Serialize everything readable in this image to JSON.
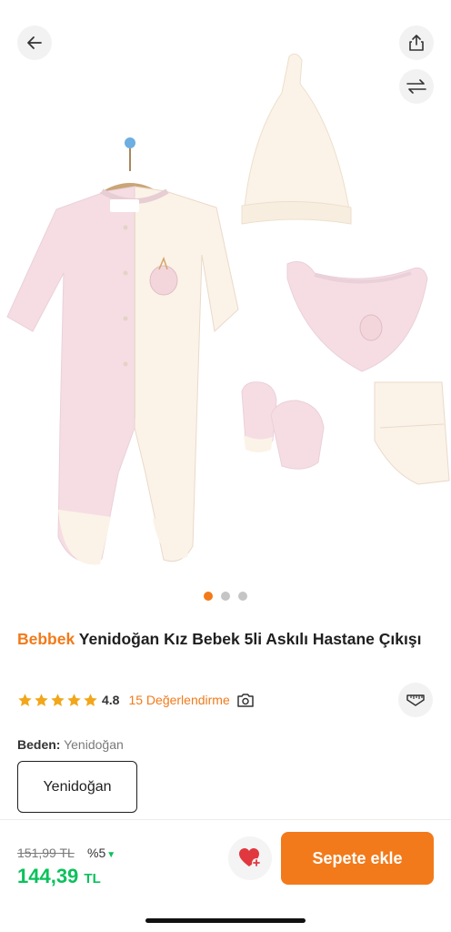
{
  "product": {
    "brand": "Bebbek",
    "name": "Yenidoğan Kız Bebek 5li Askılı Hastane Çıkışı",
    "rating": "4.8",
    "review_count_label": "15 Değerlendirme",
    "stars_filled": 5
  },
  "gallery": {
    "slide_count": 3,
    "active_slide": 1,
    "garment_label": "Bebbek",
    "colors": {
      "pink": "#f6dde4",
      "cream": "#fbf3e7",
      "accent": "#f27a1a"
    }
  },
  "size": {
    "label": "Beden:",
    "selected": "Yenidoğan",
    "options": [
      "Yenidoğan"
    ]
  },
  "pricing": {
    "old_price": "151,99 TL",
    "discount": "%5",
    "price_amount": "144,39",
    "price_currency": "TL"
  },
  "actions": {
    "add_to_cart": "Sepete ekle"
  },
  "icons": [
    "arrow-left-icon",
    "share-icon",
    "compare-arrows-icon",
    "star-icon",
    "camera-icon",
    "size-chart-icon",
    "heart-plus-icon"
  ],
  "colors": {
    "accent": "#f27a1a",
    "price_green": "#0bc15c",
    "star": "#f2a61a"
  }
}
